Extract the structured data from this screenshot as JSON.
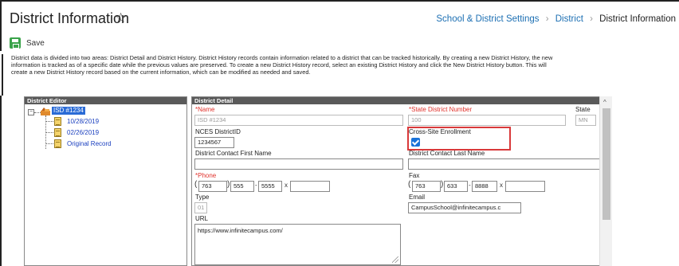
{
  "header": {
    "title": "District Information",
    "star_glyph": "☆",
    "breadcrumb": [
      {
        "label": "School & District Settings"
      },
      {
        "label": "District"
      },
      {
        "label": "District Information"
      }
    ],
    "separator": "›"
  },
  "toolbar": {
    "save_label": "Save",
    "save_icon": "save-icon",
    "accent_color": "#3aa34a"
  },
  "description": "District data is divided into two areas: District Detail and District History. District History records contain information related to a district that can be tracked historically. By creating a new District History, the new information is tracked as of a specific date while the previous values are preserved. To create a new District History record, select an existing District History and click the New District History button. This will create a new District History record based on the current information, which can be modified as needed and saved.",
  "editor": {
    "heading": "District Editor",
    "root": {
      "label": "ISD #1234",
      "expander": "−"
    },
    "items": [
      {
        "label": "10/28/2019"
      },
      {
        "label": "02/26/2019"
      },
      {
        "label": "Original Record"
      }
    ]
  },
  "detail": {
    "heading": "District Detail",
    "name": {
      "label": "*Name",
      "value": "ISD #1234"
    },
    "state_district_number": {
      "label": "*State District Number",
      "value": "100"
    },
    "state": {
      "label": "State",
      "value": "MN"
    },
    "nces": {
      "label": "NCES DistrictID",
      "value": "1234567"
    },
    "cross_site": {
      "label": "Cross-Site Enrollment",
      "checked": true
    },
    "contact_first": {
      "label": "District Contact First Name",
      "value": ""
    },
    "contact_last": {
      "label": "District Contact Last Name",
      "value": ""
    },
    "phone": {
      "label": "*Phone",
      "area": "763",
      "prefix": "555",
      "line": "5555",
      "ext_label": "x",
      "ext": ""
    },
    "fax": {
      "label": "Fax",
      "area": "763",
      "prefix": "633",
      "line": "8888",
      "ext_label": "x",
      "ext": ""
    },
    "type": {
      "label": "Type",
      "value": "01"
    },
    "email": {
      "label": "Email",
      "value": "CampusSchool@infinitecampus.c"
    },
    "url": {
      "label": "URL",
      "value": "https://www.infinitecampus.com/"
    }
  },
  "scrollbar": {
    "up_glyph": "^"
  }
}
